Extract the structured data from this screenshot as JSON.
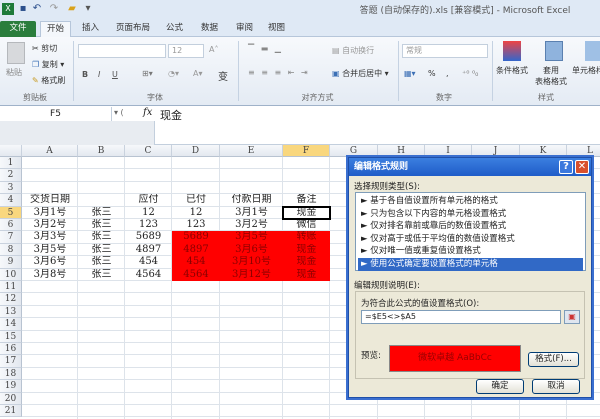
{
  "window": {
    "title": "答题 (自动保存的).xls  [兼容模式] - Microsoft Excel"
  },
  "quick_access": {
    "icons": [
      "excel-icon",
      "save-icon",
      "undo-icon",
      "redo-icon",
      "open-folder-icon",
      "customize-icon"
    ]
  },
  "tabs": [
    {
      "label": "文件"
    },
    {
      "label": "开始"
    },
    {
      "label": "插入"
    },
    {
      "label": "页面布局"
    },
    {
      "label": "公式"
    },
    {
      "label": "数据"
    },
    {
      "label": "审阅"
    },
    {
      "label": "视图"
    }
  ],
  "ribbon": {
    "clipboard": {
      "paste": "粘贴",
      "cut": "剪切",
      "copy": "复制 ▾",
      "format_painter": "格式刷",
      "label": "剪贴板"
    },
    "font": {
      "name": "",
      "size": "12",
      "grow": "A˄",
      "shrink": "A˅",
      "bold": "B",
      "italic": "I",
      "underline": "U",
      "label": "字体",
      "phonetic": "变"
    },
    "alignment": {
      "wrap": "自动换行",
      "merge": "合并后居中 ▾",
      "label": "对齐方式"
    },
    "number": {
      "format": "常规",
      "percent": "%",
      "comma": ",",
      "label": "数字"
    },
    "styles": {
      "conditional": "条件格式",
      "table": "套用\n表格格式",
      "cell": "单元格样式",
      "label": "样式"
    }
  },
  "formula_bar": {
    "name_box": "F5",
    "fx": "fx",
    "content": "现金"
  },
  "sheet": {
    "columns": [
      "A",
      "B",
      "C",
      "D",
      "E",
      "F",
      "G",
      "H",
      "I",
      "J",
      "K",
      "L"
    ],
    "selected_column": "F",
    "selected_row": 5,
    "rows": [
      {
        "n": 1,
        "cells": [
          "",
          "",
          "",
          "",
          "",
          ""
        ]
      },
      {
        "n": 2,
        "cells": [
          "",
          "",
          "",
          "",
          "",
          ""
        ]
      },
      {
        "n": 3,
        "cells": [
          "",
          "",
          "",
          "",
          "",
          ""
        ]
      },
      {
        "n": 4,
        "cells": [
          "交货日期",
          "",
          "应付",
          "已付",
          "付款日期",
          "备注"
        ]
      },
      {
        "n": 5,
        "cells": [
          "3月1号",
          "张三",
          "12",
          "12",
          "3月1号",
          "现金"
        ]
      },
      {
        "n": 6,
        "cells": [
          "3月2号",
          "张三",
          "123",
          "123",
          "3月2号",
          "微信"
        ]
      },
      {
        "n": 7,
        "cells": [
          "3月3号",
          "张三",
          "5689",
          "5689",
          "3月5号",
          "转账"
        ],
        "highlight": true
      },
      {
        "n": 8,
        "cells": [
          "3月5号",
          "张三",
          "4897",
          "4897",
          "3月6号",
          "现金"
        ],
        "highlight": true
      },
      {
        "n": 9,
        "cells": [
          "3月6号",
          "张三",
          "454",
          "454",
          "3月10号",
          "现金"
        ],
        "highlight": true
      },
      {
        "n": 10,
        "cells": [
          "3月8号",
          "张三",
          "4564",
          "4564",
          "3月12号",
          "现金"
        ],
        "highlight": true
      },
      {
        "n": 11,
        "cells": [
          "",
          "",
          "",
          "",
          "",
          ""
        ]
      }
    ],
    "highlight_color": "#ff0000"
  },
  "dialog": {
    "title": "编辑格式规则",
    "help": "?",
    "close": "✕",
    "rule_type_label": "选择规则类型(S):",
    "rule_types": [
      "► 基于各自值设置所有单元格的格式",
      "► 只为包含以下内容的单元格设置格式",
      "► 仅对排名靠前或靠后的数值设置格式",
      "► 仅对高于或低于平均值的数值设置格式",
      "► 仅对唯一值或重复值设置格式",
      "► 使用公式确定要设置格式的单元格"
    ],
    "selected_rule": 5,
    "edit_label": "编辑规则说明(E):",
    "formula_label": "为符合此公式的值设置格式(O):",
    "formula": "=$E5<>$A5",
    "preview_label": "预览:",
    "preview_text": "微软卓越  AaBbCc",
    "preview_color": "#ff0000",
    "format_button": "格式(F)...",
    "ok": "确定",
    "cancel": "取消"
  }
}
